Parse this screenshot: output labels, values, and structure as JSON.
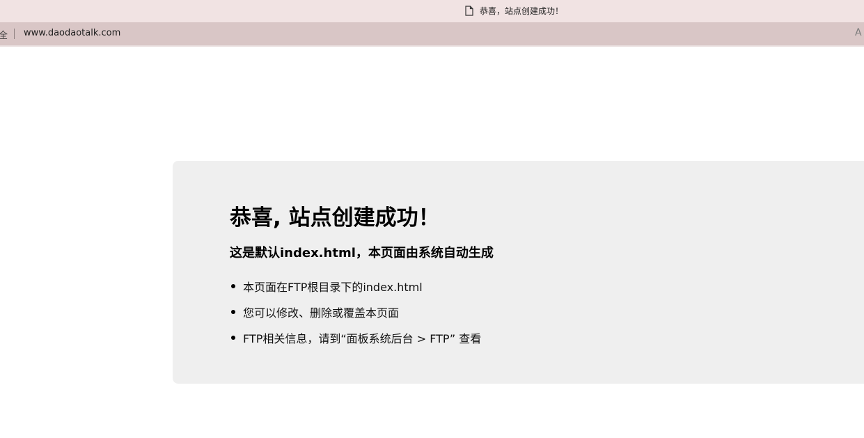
{
  "browser": {
    "tab": {
      "icon": "document-icon",
      "title": "恭喜，站点创建成功！"
    },
    "address_bar": {
      "lead_glyph": "全",
      "url": "www.daodaotalk.com",
      "trailing_icon": "read-aloud-icon",
      "trailing_glyph": "A"
    }
  },
  "page": {
    "title": "恭喜, 站点创建成功！",
    "subtitle": "这是默认index.html，本页面由系统自动生成",
    "items": [
      "本页面在FTP根目录下的index.html",
      "您可以修改、删除或覆盖本页面",
      "FTP相关信息，请到“面板系统后台 > FTP” 查看"
    ]
  },
  "colors": {
    "tabbar_bg": "#f1e3e3",
    "addrbar_bg": "#d9c6c6",
    "card_bg": "#efefef"
  }
}
